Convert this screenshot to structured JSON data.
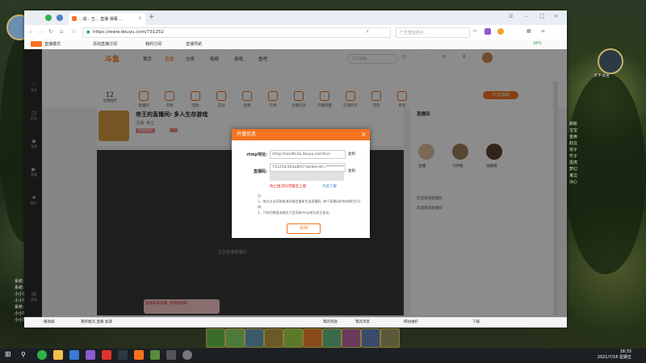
{
  "browser": {
    "tabs": [
      {
        "label": "...偷 - 王... 直播 弹幕 ..."
      }
    ],
    "new_tab": "+",
    "url": "https://www.douyu.com/731252",
    "search_placeholder": "广告智能助手 ...",
    "bookmarks": [
      {
        "label": "直播模式"
      },
      {
        "label": "添加直播订阅"
      },
      {
        "label": "我的订阅"
      },
      {
        "label": "直播导航"
      }
    ],
    "battery": "28%"
  },
  "site": {
    "logo": "斗鱼",
    "nav": [
      "首页",
      "直播",
      "分类",
      "视频",
      "游戏",
      "鱼吧"
    ],
    "search_placeholder": "正在搜索...",
    "categories": [
      {
        "label": "12",
        "sub": "主播推荐"
      },
      {
        "label": "直播间"
      },
      {
        "label": "音频"
      },
      {
        "label": "回放"
      },
      {
        "label": "互动"
      },
      {
        "label": "直播"
      },
      {
        "label": "礼物"
      },
      {
        "label": "主播任务"
      },
      {
        "label": "开播提醒"
      },
      {
        "label": "在线统计"
      },
      {
        "label": "充值"
      },
      {
        "label": "更多"
      }
    ],
    "pc_client_btn": "PC直播端",
    "sidebar": [
      "关注",
      "历史",
      "游戏",
      "视频",
      "娱乐",
      "消息"
    ],
    "room_title": "帝王的直播间: 多人生存游戏",
    "room_info": "主播: 帝王",
    "room_tags": [
      "超级明星",
      "..."
    ],
    "right_panel_title": "直播间",
    "right_users": [
      "主播",
      "TOP榜",
      "贡献榜"
    ],
    "chat_lines": [
      "欢迎来到直播间",
      "欢迎来到直播间"
    ],
    "video_hint": "正在连接直播间...",
    "warning": "直播间未开播, 请稍后刷新"
  },
  "dialog": {
    "title": "开播信息",
    "close": "×",
    "rtmp_label": "rtmp地址:",
    "rtmp_value": "rtmp://sendtc3a.douyu.com/live",
    "copy": "复制",
    "code_label": "直播码:",
    "code_value": "731252r2b3u8rtC?wsSecret=**********",
    "link_primary": "防止推流码泄露后上播",
    "link_secondary": "点此了解",
    "notes_title": "注:",
    "notes": [
      "1、每次点击获取推流码都会重新生成直播码, 每个直播码的有效期为5分钟。",
      "2、只有切换推流域名才会导致rtmp地址发生变化。"
    ],
    "confirm": "关闭"
  },
  "statusbar": [
    "播放器",
    "重新推流 直播 加速",
    "我的奖励",
    "我的消息",
    "网站维护",
    "下载"
  ],
  "game": {
    "chat": [
      "系统: 请注意",
      "系统: 请注意",
      "小小冒险家: 这...",
      "小小司机: 我...",
      "系统: 请...",
      "小小司机: 我想...",
      "小小司机: 这又是一趟..."
    ],
    "region_label": "天平道宫",
    "right_list": [
      "刷新",
      "宝宝",
      "金疾",
      "赵云",
      "双子",
      "竹子",
      "雷虎",
      "梦幻",
      "鬼泣",
      "冰心"
    ]
  },
  "taskbar": {
    "time": "18:33",
    "date": "2021/7/16 星期五"
  }
}
